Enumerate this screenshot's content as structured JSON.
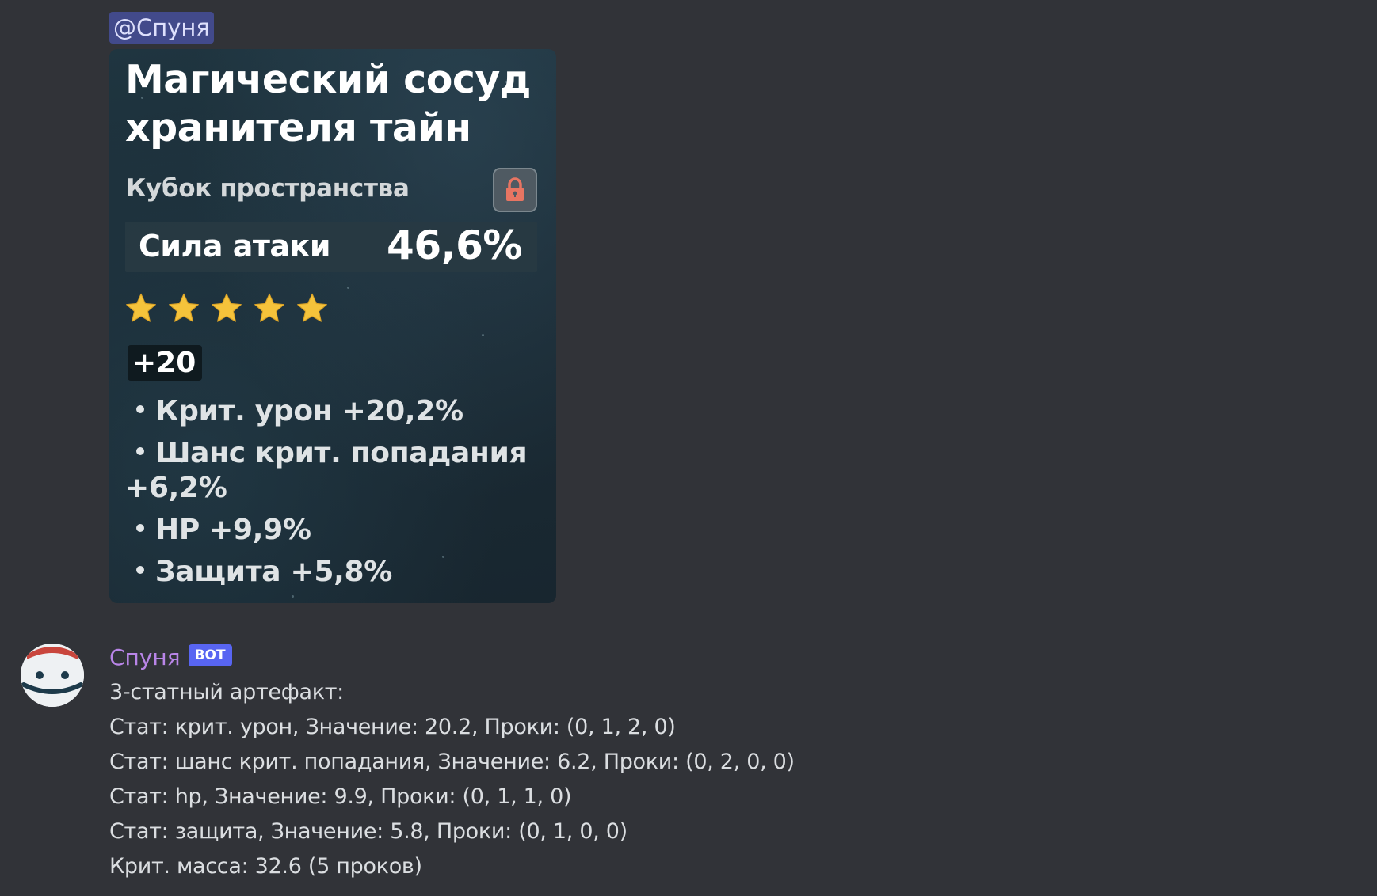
{
  "mention": {
    "text": "@Спуня"
  },
  "card": {
    "title": "Магический сосуд хранителя тайн",
    "type": "Кубок пространства",
    "main_stat": {
      "name": "Сила атаки",
      "value": "46,6%"
    },
    "rarity_stars": 5,
    "level": "+20",
    "substats": [
      "Крит. урон +20,2%",
      "Шанс крит. попадания +6,2%",
      "HP +9,9%",
      "Защита +5,8%"
    ],
    "lock_icon": "lock-icon",
    "colors": {
      "star": "#f5c33b",
      "lock": "#e87562"
    }
  },
  "message": {
    "author": "Спуня",
    "badge": "BOT",
    "author_color": "#b985e8",
    "lines": [
      "3-статный артефакт:",
      "Стат: крит. урон, Значение: 20.2, Проки: (0, 1, 2, 0)",
      "Стат: шанс крит. попадания, Значение: 6.2, Проки: (0, 2, 0, 0)",
      "Стат: hp, Значение: 9.9, Проки: (0, 1, 1, 0)",
      "Стат: защита, Значение: 5.8, Проки: (0, 1, 0, 0)",
      "Крит. масса: 32.6 (5 проков)"
    ]
  }
}
